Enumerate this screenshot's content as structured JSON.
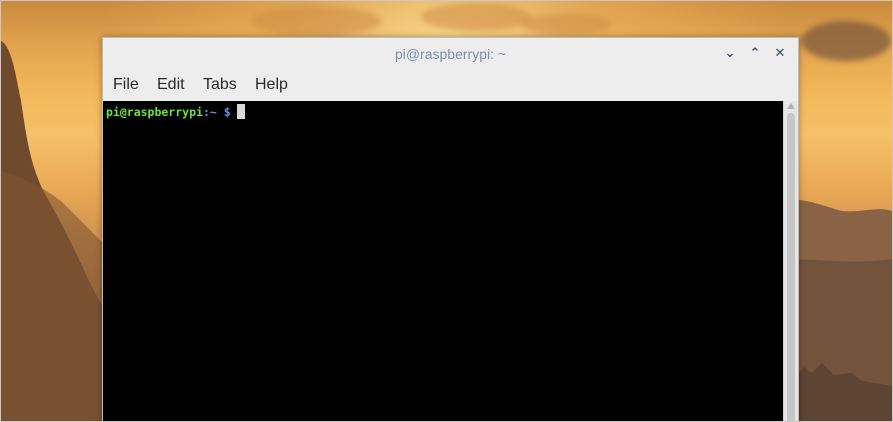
{
  "window": {
    "title": "pi@raspberrypi: ~",
    "controls": {
      "minimize": "⌄",
      "maximize": "⌃",
      "close": "✕"
    }
  },
  "menubar": {
    "items": [
      {
        "label": "File"
      },
      {
        "label": "Edit"
      },
      {
        "label": "Tabs"
      },
      {
        "label": "Help"
      }
    ]
  },
  "terminal": {
    "prompt_user_host": "pi@raspberrypi",
    "prompt_path": ":~",
    "prompt_symbol": "$",
    "background": "#000000",
    "user_color": "#6ee13a",
    "path_color": "#6b8fe0"
  },
  "icons": {
    "minimize": "chevron-down-icon",
    "maximize": "chevron-up-icon",
    "close": "close-icon"
  }
}
